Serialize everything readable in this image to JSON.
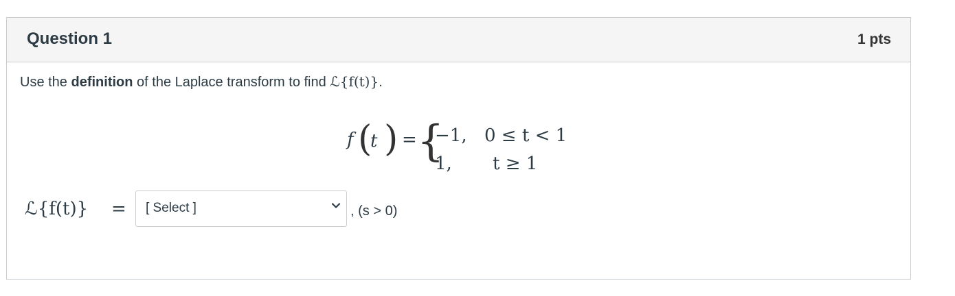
{
  "question": {
    "title": "Question 1",
    "points": "1 pts"
  },
  "prompt": {
    "part1": "Use the ",
    "bold": "definition",
    "part2": " of the Laplace transform to find ",
    "expr": "ℒ{f(t)}",
    "end": "."
  },
  "equation": {
    "f": "f",
    "t": "t",
    "equals": "=",
    "case1_value": "−1,",
    "case1_condition": "0 ≤ t < 1",
    "case2_value": "1,",
    "case2_condition": "t ≥ 1"
  },
  "answer": {
    "lhs": "ℒ{f(t)}",
    "equals": "=",
    "select_value": "[ Select ]",
    "suffix": ", (s > 0)"
  },
  "icons": {
    "dropdown": "chevron-down-icon"
  }
}
